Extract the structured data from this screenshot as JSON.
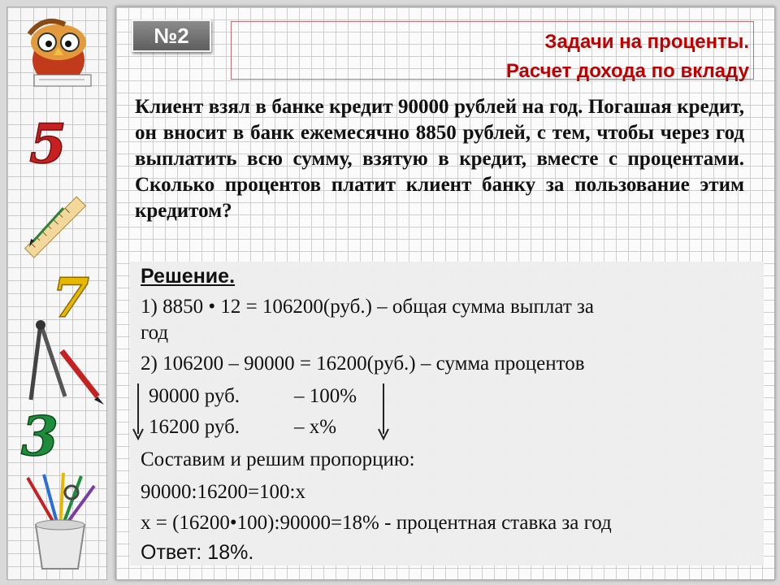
{
  "slide": {
    "number_label": "№2",
    "title_line1": "Задачи на проценты.",
    "title_line2": "Расчет дохода по вкладу"
  },
  "problem": {
    "text": "Клиент взял в банке кредит 90000 рублей на год. Погашая кредит, он вносит в банк ежемесячно 8850 рублей, с тем, чтобы через год выплатить всю сумму, взятую в кредит, вместе с процентами. Сколько процентов платит клиент банку за пользование этим кредитом?"
  },
  "solution": {
    "heading": "Решение. ",
    "step1_line1": " 1) 8850 • 12 = 106200(руб.) – общая сумма выплат за",
    "step1_line2": "год",
    "step2": "2) 106200 – 90000 = 16200(руб.) – сумма процентов",
    "prop_row1_left": "90000 руб.",
    "prop_row1_right": "– 100%",
    "prop_row2_left": "16200 руб.",
    "prop_row2_right": "–  х%",
    "instruction": "Составим и решим пропорцию:",
    "proportion": "90000:16200=100:х",
    "result": " х = (16200•100):90000=18% - процентная ставка за год",
    "answer": "Ответ: 18%."
  },
  "colors": {
    "title": "#c00000",
    "badge": "#6e6e6e",
    "digit5": "#c62020",
    "digit7": "#e8b800",
    "digit3": "#1e8c3a"
  },
  "decorations": {
    "icons": [
      "owl-icon",
      "digit-5-icon",
      "ruler-pencil-icon",
      "digit-7-icon",
      "compass-icon",
      "digit-3-icon",
      "pencil-cup-icon"
    ]
  }
}
